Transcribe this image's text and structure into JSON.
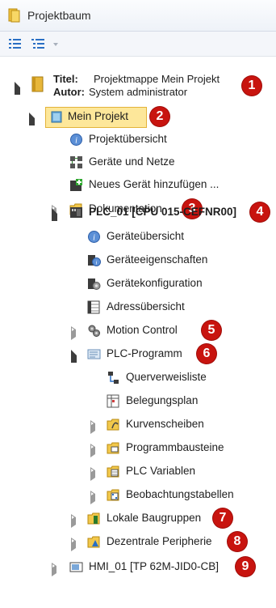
{
  "panel": {
    "title": "Projektbaum",
    "icon": "project-tree-icon"
  },
  "toolbar": {
    "buttons": [
      "list-view-icon",
      "detail-view-icon"
    ]
  },
  "root": {
    "title_label": "Titel:",
    "title_value": "Projektmappe Mein Projekt",
    "author_label": "Autor:",
    "author_value": "System administrator",
    "badge": "1"
  },
  "project": {
    "label": "Mein Projekt",
    "badge": "2"
  },
  "items": {
    "overview": "Projektübersicht",
    "devices": "Geräte und Netze",
    "add_device": "Neues Gerät hinzufügen ...",
    "docs": "Dokumentation",
    "docs_badge": "3",
    "plc": "PLC_01 [CPU 015-CEFNR00]",
    "plc_badge": "4",
    "dev_overview": "Geräteübersicht",
    "dev_props": "Geräteeigenschaften",
    "dev_config": "Gerätekonfiguration",
    "addr_overview": "Adressübersicht",
    "motion": "Motion Control",
    "motion_badge": "5",
    "plc_program": "PLC-Programm",
    "plc_program_badge": "6",
    "xref": "Querverweisliste",
    "assign": "Belegungsplan",
    "cam": "Kurvenscheiben",
    "blocks": "Programmbausteine",
    "plc_vars": "PLC Variablen",
    "watch": "Beobachtungstabellen",
    "local_modules": "Lokale Baugruppen",
    "local_modules_badge": "7",
    "dist_io": "Dezentrale Peripherie",
    "dist_io_badge": "8",
    "hmi": "HMI_01 [TP 62M-JID0-CB]",
    "hmi_badge": "9"
  },
  "colors": {
    "selection": "#fde79a",
    "badge": "#c8140f"
  }
}
